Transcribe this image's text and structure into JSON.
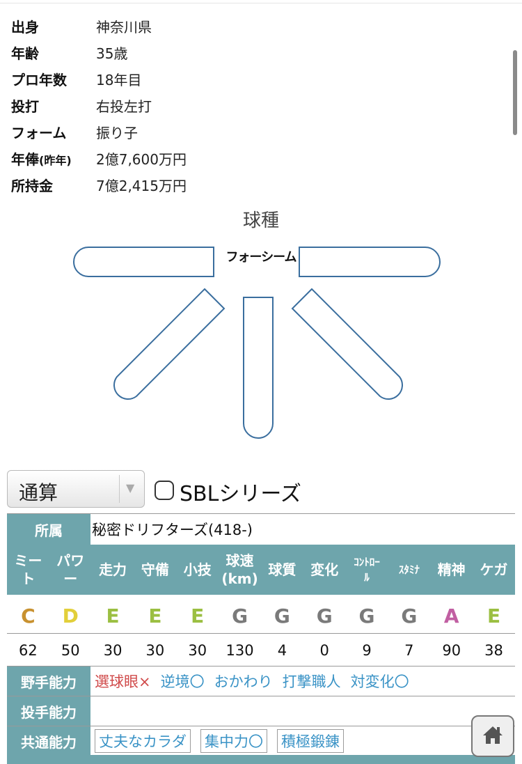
{
  "profile": [
    {
      "label": "出身",
      "value": "神奈川県"
    },
    {
      "label": "年齢",
      "value": "35歳"
    },
    {
      "label": "プロ年数",
      "value": "18年目"
    },
    {
      "label": "投打",
      "value": "右投左打"
    },
    {
      "label": "フォーム",
      "value": "振り子"
    },
    {
      "label_main": "年俸",
      "label_small": "(昨年)",
      "value": "2億7,600万円"
    },
    {
      "label": "所持金",
      "value": "7億2,415万円"
    }
  ],
  "pitches": {
    "title": "球種",
    "center_label": "フォーシーム"
  },
  "filter": {
    "selected": "通算",
    "arrow": "▼",
    "checkbox_label": "SBLシリーズ"
  },
  "affiliation": {
    "label": "所属",
    "value": "秘密ドリフターズ(418-)"
  },
  "stats": {
    "headers": [
      {
        "l1": "ミー",
        "l2": "ト"
      },
      {
        "l1": "パワ",
        "l2": "ー"
      },
      {
        "l1": "走力",
        "l2": ""
      },
      {
        "l1": "守備",
        "l2": ""
      },
      {
        "l1": "小技",
        "l2": ""
      },
      {
        "l1": "球速",
        "l2": "(km)"
      },
      {
        "l1": "球質",
        "l2": ""
      },
      {
        "l1": "変化",
        "l2": ""
      },
      {
        "l1": "ｺﾝﾄﾛｰ",
        "l2": "ﾙ"
      },
      {
        "l1": "ｽﾀﾐﾅ",
        "l2": ""
      },
      {
        "l1": "精神",
        "l2": ""
      },
      {
        "l1": "ケガ",
        "l2": ""
      }
    ],
    "grades": [
      "C",
      "D",
      "E",
      "E",
      "E",
      "G",
      "G",
      "G",
      "G",
      "G",
      "A",
      "E"
    ],
    "grade_colors": [
      "#c8912f",
      "#e2cf3a",
      "#9bbf42",
      "#9bbf42",
      "#9bbf42",
      "#7a7a7a",
      "#7a7a7a",
      "#7a7a7a",
      "#7a7a7a",
      "#7a7a7a",
      "#c15fa2",
      "#9bbf42"
    ],
    "values": [
      "62",
      "50",
      "30",
      "30",
      "30",
      "130",
      "4",
      "0",
      "9",
      "7",
      "90",
      "38"
    ]
  },
  "abilities": {
    "fielder_label": "野手能力",
    "fielder": [
      {
        "text": "選球眼×",
        "kind": "neg"
      },
      {
        "text": "逆境〇",
        "kind": "pos"
      },
      {
        "text": "おかわり",
        "kind": "pos"
      },
      {
        "text": "打撃職人",
        "kind": "pos"
      },
      {
        "text": "対変化〇",
        "kind": "pos"
      }
    ],
    "pitcher_label": "投手能力",
    "common_label": "共通能力",
    "common": [
      "丈夫なカラダ",
      "集中力〇",
      "積極鍛錬"
    ]
  },
  "colors": {
    "header_teal": "#6ea5ac",
    "pitch_outline": "#3a6e9e"
  },
  "icons": {
    "home": "home-icon",
    "checkbox": "checkbox-icon"
  }
}
